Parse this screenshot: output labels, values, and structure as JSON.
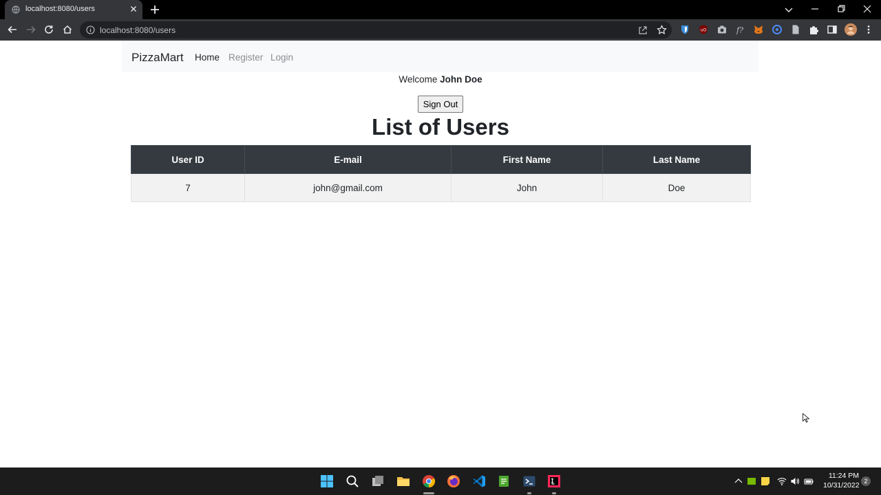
{
  "browser": {
    "tab": {
      "title": "localhost:8080/users"
    },
    "address_bar": {
      "url": "localhost:8080/users"
    },
    "extension_badge": "3"
  },
  "navbar": {
    "brand": "PizzaMart",
    "links": [
      {
        "label": "Home",
        "active": true
      },
      {
        "label": "Register",
        "active": false
      },
      {
        "label": "Login",
        "active": false
      }
    ]
  },
  "welcome": {
    "prefix": "Welcome",
    "name": "John Doe"
  },
  "signout_button": {
    "label": "Sign Out"
  },
  "heading": "List of Users",
  "table": {
    "headers": [
      "User ID",
      "E-mail",
      "First Name",
      "Last Name"
    ],
    "rows": [
      [
        "7",
        "john@gmail.com",
        "John",
        "Doe"
      ]
    ]
  },
  "taskbar": {
    "time": "11:24 PM",
    "date": "10/31/2022",
    "notification_count": "2"
  },
  "colors": {
    "navbar_bg": "#f8f9fa",
    "table_header_bg": "#343a40",
    "row_bg": "#f2f2f2",
    "chrome_dark": "#35363a"
  }
}
